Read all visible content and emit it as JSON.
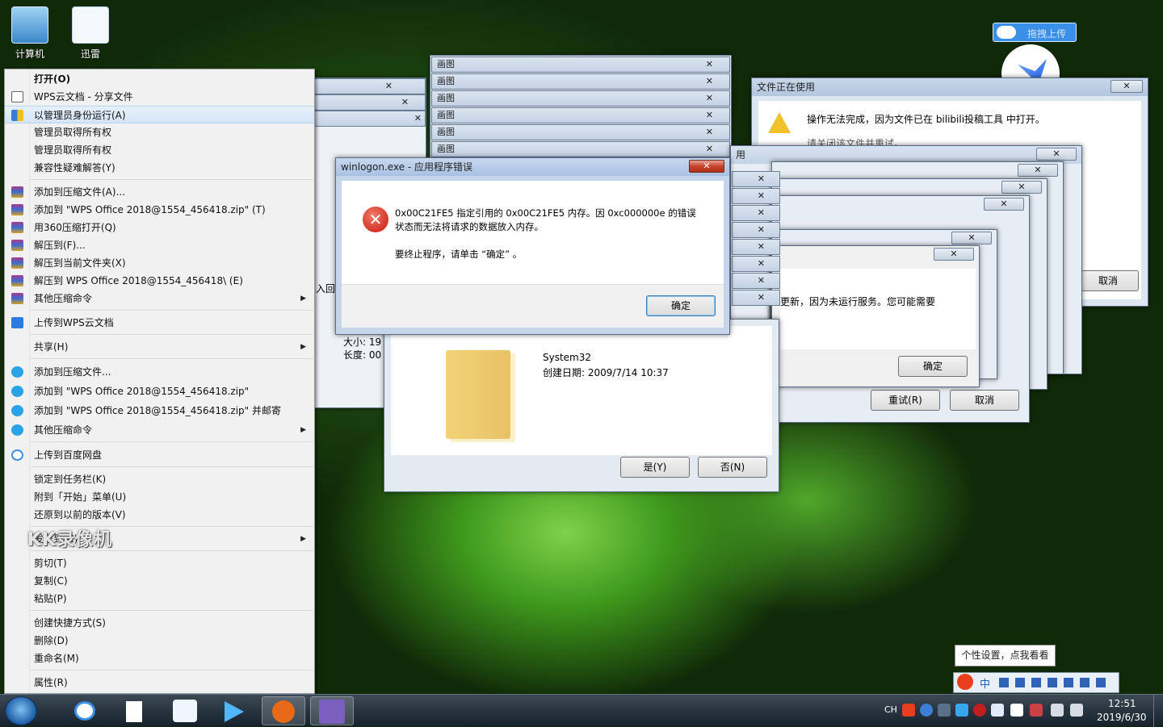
{
  "desktop": {
    "icons": [
      {
        "label": "计算机"
      },
      {
        "label": "迅雷"
      }
    ]
  },
  "context_menu": {
    "items": [
      {
        "label": "打开(O)",
        "bold": true
      },
      {
        "label": "WPS云文档 - 分享文件"
      },
      {
        "label": "以管理员身份运行(A)",
        "highlighted": true
      },
      {
        "label": "管理员取得所有权"
      },
      {
        "label": "管理员取得所有权"
      },
      {
        "label": "兼容性疑难解答(Y)"
      },
      {
        "label": "添加到压缩文件(A)..."
      },
      {
        "label": "添加到 \"WPS Office 2018@1554_456418.zip\" (T)"
      },
      {
        "label": "用360压缩打开(Q)"
      },
      {
        "label": "解压到(F)..."
      },
      {
        "label": "解压到当前文件夹(X)"
      },
      {
        "label": "解压到 WPS Office 2018@1554_456418\\ (E)"
      },
      {
        "label": "其他压缩命令"
      },
      {
        "label": "上传到WPS云文档"
      },
      {
        "label": "共享(H)"
      },
      {
        "label": "添加到压缩文件..."
      },
      {
        "label": "添加到 \"WPS Office 2018@1554_456418.zip\""
      },
      {
        "label": "添加到 \"WPS Office 2018@1554_456418.zip\" 并邮寄"
      },
      {
        "label": "其他压缩命令"
      },
      {
        "label": "上传到百度网盘"
      },
      {
        "label": "锁定到任务栏(K)"
      },
      {
        "label": "附到「开始」菜单(U)"
      },
      {
        "label": "还原到以前的版本(V)"
      },
      {
        "label": "发送到(N)"
      },
      {
        "label": "剪切(T)"
      },
      {
        "label": "复制(C)"
      },
      {
        "label": "粘贴(P)"
      },
      {
        "label": "创建快捷方式(S)"
      },
      {
        "label": "删除(D)"
      },
      {
        "label": "重命名(M)"
      },
      {
        "label": "属性(R)"
      }
    ],
    "watermark": "KK录像机"
  },
  "paint_windows": {
    "title": "画图",
    "close": "✕"
  },
  "error_dialog": {
    "title": "winlogon.exe - 应用程序错误",
    "message_line1": "0x00C21FE5 指定引用的 0x00C21FE5 内存。因 0xc000000e 的错误",
    "message_line2": "状态而无法将请求的数据放入内存。",
    "message_line3": "要终止程序，请单击 “确定” 。",
    "ok_button": "确定"
  },
  "file_dialog": {
    "folder_name": "System32",
    "created": "创建日期: 2009/7/14 10:37",
    "yes_button": "是(Y)",
    "no_button": "否(N)",
    "partial_left1": "入回",
    "partial_size": "大小: 19",
    "partial_length": "长度: 00"
  },
  "in_use_dialog": {
    "title": "文件正在使用",
    "message": "操作无法完成，因为文件已在 bilibili投稿工具 中打开。",
    "message2": "请关闭该文件并重试。",
    "cancel_button": "取消",
    "title_fragment": "用"
  },
  "stack_dialogs": {
    "service_msg": "更新，因为未运行服务。您可能需要",
    "ok_button": "确定",
    "retry_button": "重试(R)",
    "cancel_button": "取消"
  },
  "upload_widget": {
    "label": "拖拽上传"
  },
  "ime_tip": "个性设置，点我看看",
  "ime_bar": {
    "lang": "中"
  },
  "taskbar": {
    "lang": "CH",
    "time": "12:51",
    "date": "2019/6/30"
  }
}
